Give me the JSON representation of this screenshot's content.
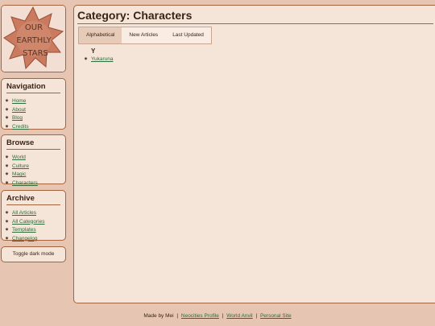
{
  "logo": {
    "text": "OUR EARTHLY STARS",
    "line1": "OUR",
    "line2": "EARTHLY",
    "line3": "STARS"
  },
  "navigation": {
    "title": "Navigation",
    "items": [
      {
        "label": "Home",
        "icon": "star-bullet-icon"
      },
      {
        "label": "About",
        "icon": "star-bullet-icon"
      },
      {
        "label": "Blog",
        "icon": "star-bullet-icon"
      },
      {
        "label": "Credits",
        "icon": "star-bullet-icon"
      }
    ]
  },
  "browse": {
    "title": "Browse",
    "items": [
      {
        "label": "World"
      },
      {
        "label": "Culture"
      },
      {
        "label": "Magic"
      },
      {
        "label": "Characters"
      }
    ]
  },
  "archive": {
    "title": "Archive",
    "items": [
      {
        "label": "All Articles"
      },
      {
        "label": "All Categories"
      },
      {
        "label": "Templates"
      },
      {
        "label": "Changelog"
      }
    ]
  },
  "dark_mode": {
    "label": "Toggle dark mode"
  },
  "page": {
    "title": "Category: Characters",
    "tabs": [
      {
        "label": "Alphabetical",
        "active": true
      },
      {
        "label": "New Articles",
        "active": false
      },
      {
        "label": "Last Updated",
        "active": false
      }
    ],
    "groups": [
      {
        "letter": "Y",
        "articles": [
          "Yukaruna"
        ]
      }
    ]
  },
  "footer": {
    "made_by": "Made by Mei",
    "links": [
      "Neocities Profile",
      "World Anvil",
      "Personal Site"
    ],
    "separator": "|"
  },
  "colors": {
    "background": "#e7c5b3",
    "panel": "#f5e4d8",
    "border": "#a4643f",
    "link": "#2f6b3a",
    "logo_star": "#c97a5f"
  }
}
